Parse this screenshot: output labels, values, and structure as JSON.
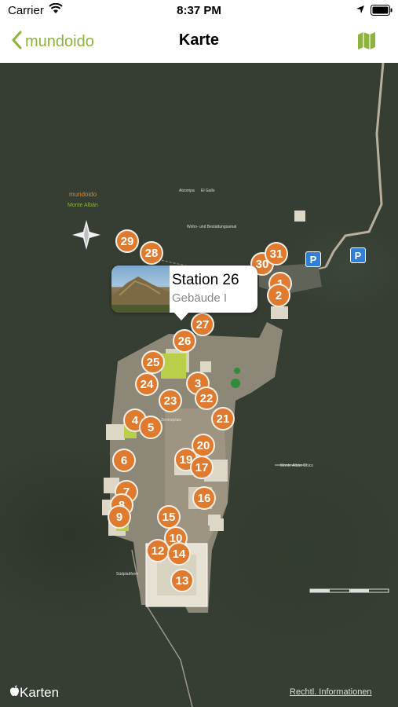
{
  "status_bar": {
    "carrier": "Carrier",
    "time": "8:37 PM"
  },
  "nav": {
    "back_label": "mundoido",
    "title": "Karte"
  },
  "callout": {
    "title": "Station 26",
    "subtitle": "Gebäude I"
  },
  "map": {
    "brand_name": "mundoido",
    "brand_place": "Monte Albán",
    "attribution": "Karten",
    "legal": "Rechtl. Informationen",
    "parking_label": "P",
    "labels": [
      "Wohn- und Bestattungsareal",
      "Zentralplatz",
      "Südplattform",
      "Monte Albán Chico",
      "Atzompa",
      "El Gallo"
    ],
    "pins": [
      "29",
      "28",
      "30",
      "31",
      "1",
      "2",
      "27",
      "26",
      "25",
      "24",
      "3",
      "23",
      "22",
      "21",
      "4",
      "5",
      "20",
      "6",
      "19",
      "17",
      "7",
      "8",
      "16",
      "9",
      "15",
      "10",
      "12",
      "14",
      "13"
    ]
  },
  "colors": {
    "accent": "#8db33a",
    "pin": "#e07a2f",
    "parking": "#2f7fd6"
  }
}
